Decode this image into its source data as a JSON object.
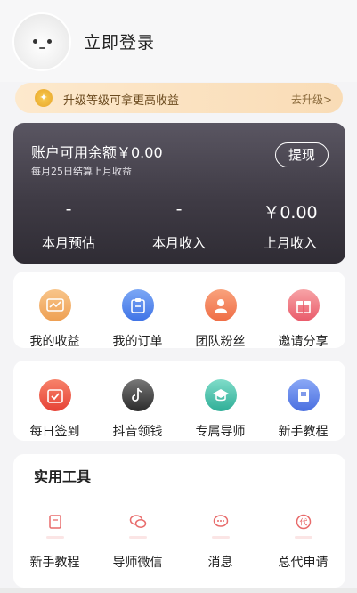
{
  "header": {
    "avatar_icon": "ghost-avatar-icon",
    "login_label": "立即登录"
  },
  "upgrade_banner": {
    "icon": "coin-icon",
    "text": "升级等级可拿更高收益",
    "link_label": "去升级>"
  },
  "balance": {
    "label": "账户可用余额￥0.00",
    "note": "每月25日结算上月收益",
    "withdraw_label": "提现",
    "stats": [
      {
        "value": "-",
        "label": "本月预估"
      },
      {
        "value": "-",
        "label": "本月收入"
      },
      {
        "value": "￥0.00",
        "label": "上月收入"
      }
    ]
  },
  "menu_row1": [
    {
      "label": "我的收益",
      "icon": "earnings-chart-icon"
    },
    {
      "label": "我的订单",
      "icon": "order-clipboard-icon"
    },
    {
      "label": "团队粉丝",
      "icon": "team-user-icon"
    },
    {
      "label": "邀请分享",
      "icon": "gift-icon"
    }
  ],
  "menu_row2": [
    {
      "label": "每日签到",
      "icon": "calendar-check-icon"
    },
    {
      "label": "抖音领钱",
      "icon": "tiktok-icon"
    },
    {
      "label": "专属导师",
      "icon": "mentor-cap-icon"
    },
    {
      "label": "新手教程",
      "icon": "book-icon"
    }
  ],
  "tools": {
    "title": "实用工具",
    "items": [
      {
        "label": "新手教程",
        "icon": "book-outline-icon"
      },
      {
        "label": "导师微信",
        "icon": "wechat-icon"
      },
      {
        "label": "消息",
        "icon": "chat-bubble-icon"
      },
      {
        "label": "总代申请",
        "icon": "agent-badge-icon"
      }
    ]
  },
  "colors": {
    "accent_tool": "#e86b6b",
    "balance_card": "#3f3b45",
    "banner": "#f9dcb6"
  }
}
